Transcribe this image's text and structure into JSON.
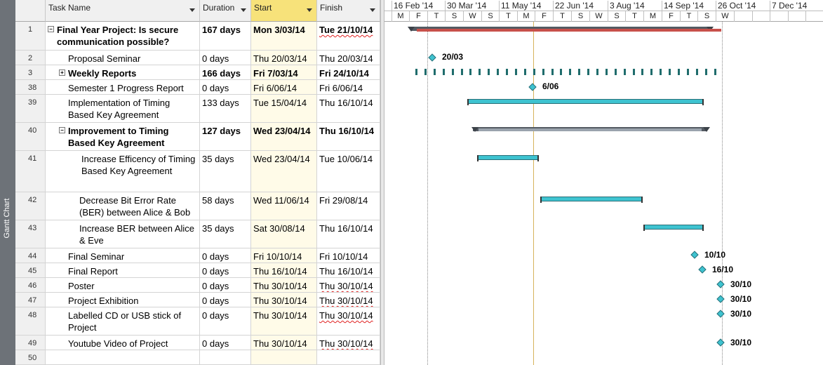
{
  "view_bar": {
    "label": "Gantt Chart"
  },
  "columns": {
    "name": "Task Name",
    "duration": "Duration",
    "start": "Start",
    "finish": "Finish"
  },
  "tasks": [
    {
      "id": "1",
      "name": "Final Year Project: Is secure communication possible?",
      "duration": "167 days",
      "start": "Mon 3/03/14",
      "finish": "Tue 21/10/14"
    },
    {
      "id": "2",
      "name": "Proposal Seminar",
      "duration": "0 days",
      "start": "Thu 20/03/14",
      "finish": "Thu 20/03/14"
    },
    {
      "id": "3",
      "name": "Weekly Reports",
      "duration": "166 days",
      "start": "Fri 7/03/14",
      "finish": "Fri 24/10/14"
    },
    {
      "id": "38",
      "name": "Semester 1 Progress Report",
      "duration": "0 days",
      "start": "Fri 6/06/14",
      "finish": "Fri 6/06/14"
    },
    {
      "id": "39",
      "name": "Implementation of Timing Based Key Agreement",
      "duration": "133 days",
      "start": "Tue 15/04/14",
      "finish": "Thu 16/10/14"
    },
    {
      "id": "40",
      "name": "Improvement to Timing Based Key Agreement",
      "duration": "127 days",
      "start": "Wed 23/04/14",
      "finish": "Thu 16/10/14"
    },
    {
      "id": "41",
      "name": "Increase Efficency of Timing Based Key Agreement",
      "duration": "35 days",
      "start": "Wed 23/04/14",
      "finish": "Tue 10/06/14"
    },
    {
      "id": "42",
      "name": "Decrease Bit Error Rate (BER) between Alice & Bob",
      "duration": "58 days",
      "start": "Wed 11/06/14",
      "finish": "Fri 29/08/14"
    },
    {
      "id": "43",
      "name": "Increase BER between Alice & Eve",
      "duration": "35 days",
      "start": "Sat 30/08/14",
      "finish": "Thu 16/10/14"
    },
    {
      "id": "44",
      "name": "Final Seminar",
      "duration": "0 days",
      "start": "Fri 10/10/14",
      "finish": "Fri 10/10/14"
    },
    {
      "id": "45",
      "name": "Final Report",
      "duration": "0 days",
      "start": "Thu 16/10/14",
      "finish": "Thu 16/10/14"
    },
    {
      "id": "46",
      "name": "Poster",
      "duration": "0 days",
      "start": "Thu 30/10/14",
      "finish": "Thu 30/10/14"
    },
    {
      "id": "47",
      "name": "Project Exhibition",
      "duration": "0 days",
      "start": "Thu 30/10/14",
      "finish": "Thu 30/10/14"
    },
    {
      "id": "48",
      "name": "Labelled CD or USB stick of Project",
      "duration": "0 days",
      "start": "Thu 30/10/14",
      "finish": "Thu 30/10/14"
    },
    {
      "id": "49",
      "name": "Youtube Video of Project",
      "duration": "0 days",
      "start": "Thu 30/10/14",
      "finish": "Thu 30/10/14"
    },
    {
      "id": "50",
      "name": "",
      "duration": "",
      "start": "",
      "finish": ""
    }
  ],
  "timescale": {
    "top": [
      "16 Feb '14",
      "30 Mar '14",
      "11 May '14",
      "22 Jun '14",
      "3 Aug '14",
      "14 Sep '14",
      "26 Oct '14",
      "7 Dec '14"
    ],
    "bottom": [
      "M",
      "F",
      "T",
      "S",
      "W",
      "S",
      "T",
      "M",
      "F",
      "T",
      "S",
      "W",
      "S",
      "T",
      "M",
      "F",
      "T",
      "S",
      "W"
    ]
  },
  "milestone_labels": [
    "20/03",
    "6/06",
    "10/10",
    "16/10",
    "30/10",
    "30/10",
    "30/10",
    "30/10"
  ],
  "colors": {
    "task_bar": "#3ec3d0",
    "summary_bar": "#545b63",
    "project_summary": "#c8504b",
    "selected_header": "#f7e27a"
  }
}
